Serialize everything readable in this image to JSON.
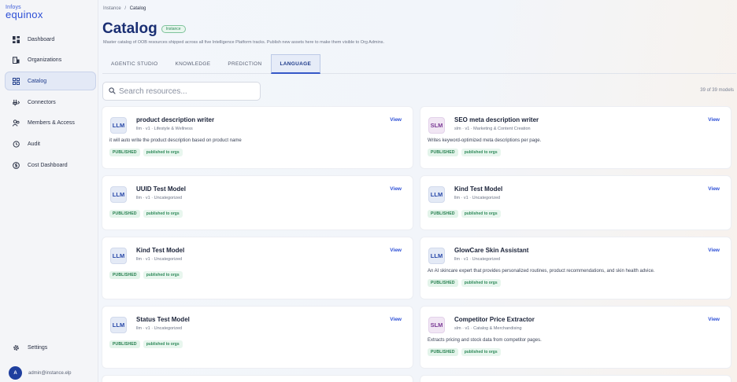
{
  "brand": {
    "top": "Infoys",
    "main": "equinox"
  },
  "sidebar": {
    "items": [
      {
        "label": "Dashboard",
        "icon": "dashboard-icon"
      },
      {
        "label": "Organizations",
        "icon": "building-icon"
      },
      {
        "label": "Catalog",
        "icon": "grid-icon",
        "active": true
      },
      {
        "label": "Connectors",
        "icon": "connector-icon"
      },
      {
        "label": "Members & Access",
        "icon": "members-icon"
      },
      {
        "label": "Audit",
        "icon": "history-icon"
      },
      {
        "label": "Cost Dashboard",
        "icon": "dollar-icon"
      }
    ],
    "settings_label": "Settings",
    "user": {
      "initial": "A",
      "email": "admin@instance.elp"
    }
  },
  "breadcrumb": {
    "root": "Instance",
    "sep": "/",
    "current": "Catalog"
  },
  "page": {
    "title": "Catalog",
    "badge": "Instance",
    "subtitle": "Master catalog of OOB resources shipped across all five Intelligence Platform tracks. Publish new assets here to make them visible to Org Admins."
  },
  "tabs": [
    "AGENTIC STUDIO",
    "KNOWLEDGE",
    "PREDICTION",
    "LANGUAGE"
  ],
  "active_tab": "LANGUAGE",
  "search": {
    "placeholder": "Search resources..."
  },
  "count_text": "39 of 39 models",
  "view_label": "View",
  "cards": [
    {
      "chip": "LLM",
      "title": "product description writer",
      "meta": "llm · v1 · Lifestyle & Wellness",
      "desc": "it will auto write the product description based on product name",
      "status": "PUBLISHED",
      "audience": "published to orgs"
    },
    {
      "chip": "SLM",
      "title": "SEO meta description writer",
      "meta": "slm · v1 · Marketing & Content Creation",
      "desc": "Writes keyword-optimized meta descriptions per page.",
      "status": "PUBLISHED",
      "audience": "published to orgs"
    },
    {
      "chip": "LLM",
      "title": "UUID Test Model",
      "meta": "llm · v1 · Uncategorized",
      "desc": "",
      "status": "PUBLISHED",
      "audience": "published to orgs"
    },
    {
      "chip": "LLM",
      "title": "Kind Test Model",
      "meta": "llm · v1 · Uncategorized",
      "desc": "",
      "status": "PUBLISHED",
      "audience": "published to orgs"
    },
    {
      "chip": "LLM",
      "title": "Kind Test Model",
      "meta": "llm · v1 · Uncategorized",
      "desc": "",
      "status": "PUBLISHED",
      "audience": "published to orgs"
    },
    {
      "chip": "LLM",
      "title": "GlowCare Skin Assistant",
      "meta": "llm · v1 · Uncategorized",
      "desc": "An AI skincare expert that provides personalized routines, product recommendations, and skin health advice.",
      "status": "PUBLISHED",
      "audience": "published to orgs"
    },
    {
      "chip": "LLM",
      "title": "Status Test Model",
      "meta": "llm · v1 · Uncategorized",
      "desc": "",
      "status": "PUBLISHED",
      "audience": "published to orgs"
    },
    {
      "chip": "SLM",
      "title": "Competitor Price Extractor",
      "meta": "slm · v1 · Catalog & Merchandising",
      "desc": "Extracts pricing and stock data from competitor pages.",
      "status": "PUBLISHED",
      "audience": "published to orgs"
    }
  ]
}
